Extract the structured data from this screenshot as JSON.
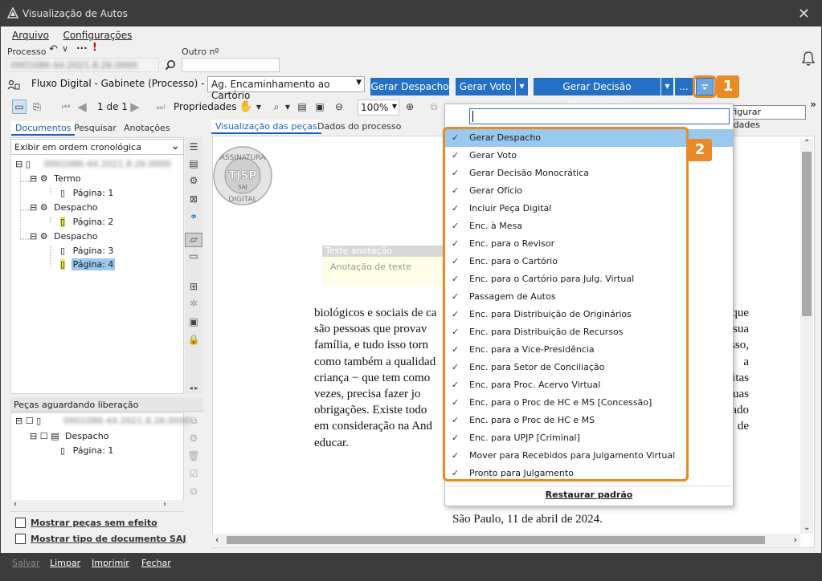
{
  "window": {
    "title": "Visualização de Autos"
  },
  "menu": [
    "Arquivo",
    "Configurações"
  ],
  "process": {
    "label": "Processo",
    "other_label": "Outro nº",
    "blurred_number": "0001086-44.2021.8.26.0000"
  },
  "flow": {
    "prefix": "Fluxo Digital - Gabinete (Processo) - Fila:",
    "queue_value": "Ag. Encaminhamento ao Cartório",
    "buttons": [
      "Gerar Despacho",
      "Gerar Voto",
      "Gerar Decisão Monocrática",
      "..."
    ]
  },
  "toolbar": {
    "page_indicator": "1 de 1",
    "properties_label": "Propriedades",
    "zoom_value": "100%"
  },
  "tooltip": "Configurar atividades",
  "left_tabs": [
    "Documentos",
    "Pesquisar",
    "Anotações"
  ],
  "order_select": "Exibir em ordem cronológica",
  "tree": {
    "root": "0001086-44.2021.8.26.0000",
    "groups": [
      {
        "label": "Termo",
        "pages": [
          "Página: 1"
        ]
      },
      {
        "label": "Despacho",
        "pages": [
          "Página: 2"
        ]
      },
      {
        "label": "Despacho",
        "pages": [
          "Página: 3",
          "Página: 4"
        ]
      }
    ]
  },
  "pending": {
    "header": "Peças aguardando liberação",
    "root": "0001086-44.2021.8.26.0000",
    "group": "Despacho",
    "page": "Página: 1"
  },
  "left_checkboxes": [
    "Mostrar peças sem efeito",
    "Mostrar tipo de documento SAJ"
  ],
  "viewer_tabs": [
    "Visualização das peças",
    "Dados do processo"
  ],
  "seal": {
    "top": "ASSINATURA",
    "center": "TJSP",
    "sub": "SAJ",
    "bottom": "DIGITAL"
  },
  "annotation": {
    "title": "Teste anotação",
    "body": "Anotação de texte"
  },
  "document_lines": [
    {
      "left": "biológicos e sociais de ca",
      "right": "que"
    },
    {
      "left": "são pessoas que provav",
      "right": "sua"
    },
    {
      "left": "família, e tudo isso torn",
      "right": "sso,"
    },
    {
      "left": "como também a qualidad",
      "right": "a"
    },
    {
      "left": "criança − que tem como",
      "right": "itas"
    },
    {
      "left": "vezes, precisa fazer jo",
      "right": "uas"
    },
    {
      "left": "obrigações. Existe todo",
      "right": "ado"
    },
    {
      "left": "em consideração na And",
      "right": "de"
    },
    {
      "left": "educar.",
      "right": ""
    }
  ],
  "signature_line": "São Paulo, 11 de abril de 2024.",
  "dropdown": {
    "items": [
      "Gerar Despacho",
      "Gerar Voto",
      "Gerar Decisão Monocrática",
      "Gerar Ofício",
      "Incluir Peça Digital",
      "Enc. à Mesa",
      "Enc. para o Revisor",
      "Enc. para o Cartório",
      "Enc. para o Cartório para Julg. Virtual",
      "Passagem de Autos",
      "Enc. para Distribuição de Originários",
      "Enc. para Distribuição de Recursos",
      "Enc. para a Vice-Presidência",
      "Enc. para Setor de Conciliação",
      "Enc. para Proc. Acervo Virtual",
      "Enc. para o Proc de HC e MS [Concessão]",
      "Enc. para o Proc de HC e MS",
      "Enc. para UPJP [Criminal]",
      "Mover para Recebidos para Julgamento Virtual",
      "Pronto para Julgamento"
    ],
    "restore": "Restaurar padrão"
  },
  "badges": [
    "1",
    "2"
  ],
  "footer": [
    "Salvar",
    "Limpar",
    "Imprimir",
    "Fechar"
  ],
  "colors": {
    "accent": "#2470c4",
    "highlight": "#e88a26",
    "selection": "#99c9ef"
  }
}
